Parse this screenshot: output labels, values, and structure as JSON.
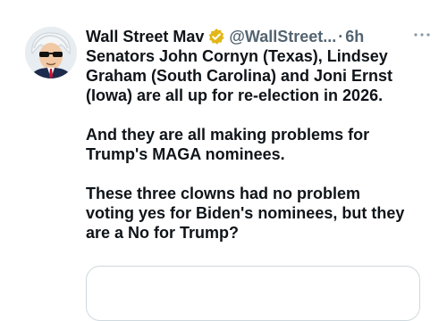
{
  "tweet": {
    "display_name": "Wall Street Mav",
    "handle": "@WallStreet...",
    "separator": "·",
    "time": "6h",
    "paragraphs": [
      "Senators John Cornyn (Texas), Lindsey\nGraham (South Carolina) and Joni Ernst\n(Iowa) are all up for re-election in 2026.",
      "And they are all making problems for\nTrump's MAGA nominees.",
      "These three clowns had no problem\nvoting yes for Biden's nominees, but they\nare a No for Trump?"
    ]
  },
  "icons": {
    "verified": "verified-badge-icon",
    "more": "more-dots-icon"
  },
  "colors": {
    "text": "#0f1419",
    "secondary": "#536471",
    "verified_gold": "#e2b719",
    "card_border": "#cfd9de"
  }
}
